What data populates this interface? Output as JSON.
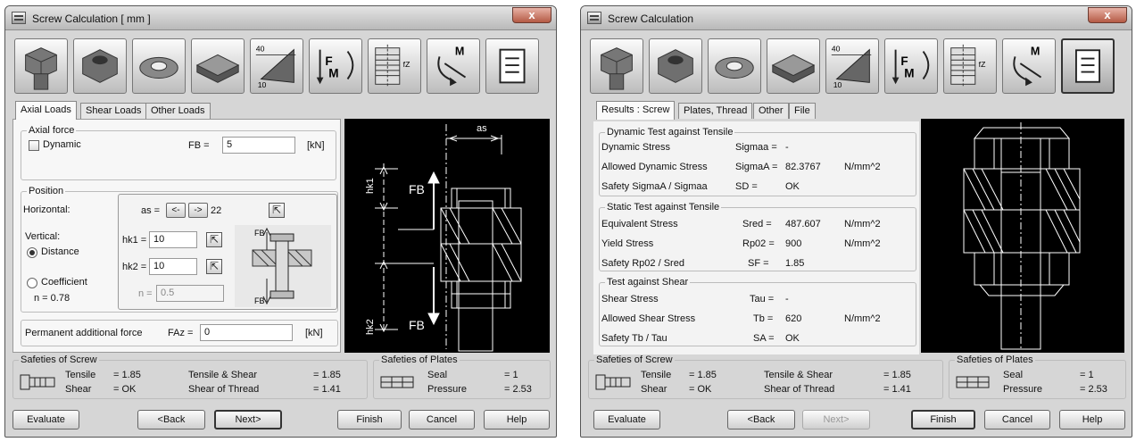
{
  "left": {
    "title": "Screw Calculation [ mm ]",
    "close": "x",
    "tabs": [
      "Axial Loads",
      "Shear Loads",
      "Other Loads"
    ],
    "axial_force": {
      "group": "Axial force",
      "dynamic_label": "Dynamic",
      "fb_label": "FB =",
      "fb_value": "5",
      "fb_unit": "[kN]"
    },
    "position": {
      "group": "Position",
      "horizontal_label": "Horizontal:",
      "as_label": "as =",
      "btn_left": "<-",
      "btn_right": "->",
      "as_value": "22",
      "vertical_label": "Vertical:",
      "distance_label": "Distance",
      "coefficient_label": "Coefficient",
      "n_display": "n = 0.78",
      "hk1_label": "hk1 =",
      "hk1_value": "10",
      "hk2_label": "hk2 =",
      "hk2_value": "10",
      "n_input_label": "n =",
      "n_input_value": "0.5",
      "fb_mini": "FB"
    },
    "permanent": {
      "label": "Permanent additional force",
      "faz_label": "FAz =",
      "faz_value": "0",
      "unit": "[kN]"
    },
    "drawing": {
      "as": "as",
      "hk1": "hk1",
      "hk2": "hk2",
      "fb": "FB"
    }
  },
  "right": {
    "title": "Screw Calculation",
    "close": "x",
    "tabs": [
      "Results : Screw",
      "Plates, Thread",
      "Other",
      "File"
    ],
    "dynamic": {
      "group": "Dynamic Test against Tensile",
      "rows": [
        [
          "Dynamic Stress",
          "Sigmaa =",
          "-",
          ""
        ],
        [
          "Allowed Dynamic Stress",
          "SigmaA =",
          "82.3767",
          "N/mm^2"
        ],
        [
          "Safety SigmaA / Sigmaa",
          "SD =",
          "OK",
          ""
        ]
      ]
    },
    "static": {
      "group": "Static Test against Tensile",
      "rows": [
        [
          "Equivalent Stress",
          "Sred =",
          "487.607",
          "N/mm^2"
        ],
        [
          "Yield Stress",
          "Rp02 =",
          "900",
          "N/mm^2"
        ],
        [
          "Safety Rp02 / Sred",
          "SF =",
          "1.85",
          ""
        ]
      ]
    },
    "shear": {
      "group": "Test against Shear",
      "rows": [
        [
          "Shear Stress",
          "Tau =",
          "-",
          ""
        ],
        [
          "Allowed Shear Stress",
          "Tb =",
          "620",
          "N/mm^2"
        ],
        [
          "Safety Tb / Tau",
          "SA =",
          "OK",
          ""
        ]
      ]
    }
  },
  "safeties": {
    "screw_title": "Safeties of Screw",
    "tensile_label": "Tensile",
    "tensile_value": "= 1.85",
    "shear_label": "Shear",
    "shear_value": "= OK",
    "ts_label": "Tensile & Shear",
    "ts_value": "= 1.85",
    "thread_label": "Shear of Thread",
    "thread_value": "= 1.41",
    "plates_title": "Safeties of Plates",
    "seal_label": "Seal",
    "seal_value": "= 1",
    "pressure_label": "Pressure",
    "pressure_value": "= 2.53"
  },
  "buttons": {
    "evaluate": "Evaluate",
    "back": "<Back",
    "next": "Next>",
    "finish": "Finish",
    "cancel": "Cancel",
    "help": "Help"
  },
  "toolbar_icons": [
    "hex-bolt-icon",
    "hex-nut-icon",
    "washer-icon",
    "plates-icon",
    "angled-plate-icon",
    "force-moment-icon",
    "thread-section-icon",
    "moment-icon",
    "report-icon"
  ]
}
